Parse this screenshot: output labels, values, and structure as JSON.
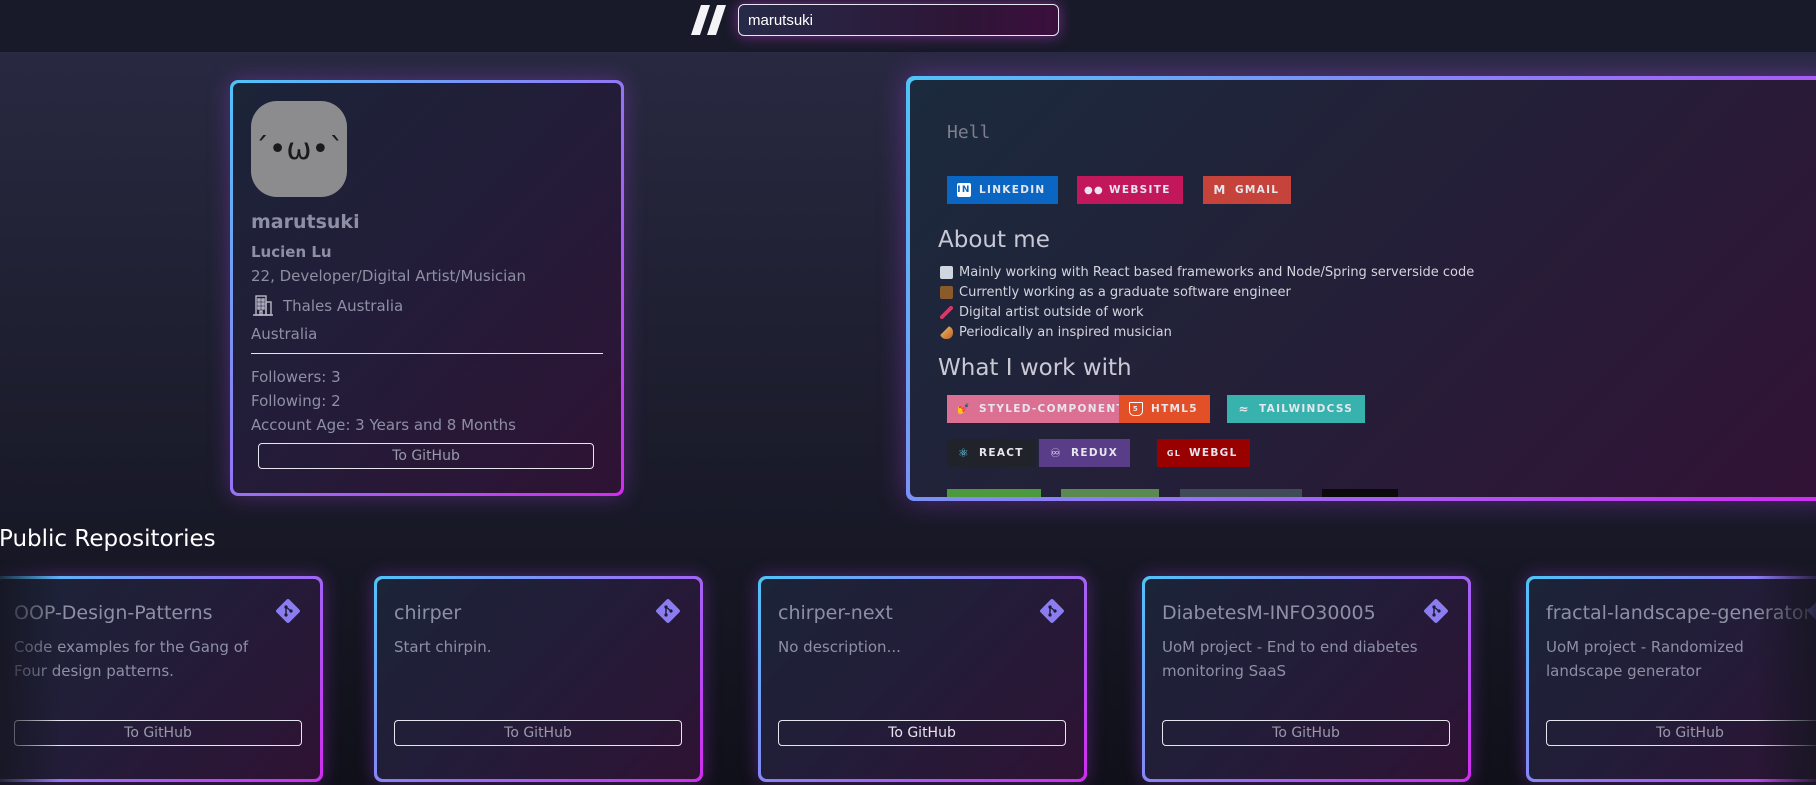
{
  "search": {
    "value": "marutsuki"
  },
  "profile": {
    "avatar_text": "´•ω•`",
    "username": "marutsuki",
    "name": "Lucien Lu",
    "bio": "22, Developer/Digital Artist/Musician",
    "company": "Thales Australia",
    "location": "Australia",
    "followers": "Followers: 3",
    "following": "Following: 2",
    "account_age": "Account Age: 3 Years and 8 Months",
    "button": "To GitHub"
  },
  "readme": {
    "typing_text": "Hell",
    "contact_badges": [
      {
        "label": "LINKEDIN",
        "color": "#0a66c2",
        "icon": "linkedin-icon"
      },
      {
        "label": "WEBSITE",
        "color": "#c2185b",
        "icon": "medium-icon"
      },
      {
        "label": "GMAIL",
        "color": "#c5433a",
        "icon": "gmail-icon"
      }
    ],
    "about_heading": "About me",
    "about_items": [
      "Mainly working with React based frameworks and Node/Spring serverside code",
      "Currently working as a graduate software engineer",
      "Digital artist outside of work",
      "Periodically an inspired musician"
    ],
    "work_heading": "What I work with",
    "tech_badges": [
      {
        "label": "STYLED-COMPONENTS",
        "color": "#db7093",
        "icon": "styled-components-icon"
      },
      {
        "label": "HTML5",
        "color": "#e34f26",
        "icon": "html5-icon"
      },
      {
        "label": "TAILWINDCSS",
        "color": "#38b2ac",
        "icon": "tailwind-icon"
      },
      {
        "label": "REACT",
        "color": "#20232a",
        "icon": "react-icon"
      },
      {
        "label": "REDUX",
        "color": "#593d88",
        "icon": "redux-icon"
      },
      {
        "label": "WEBGL",
        "color": "#990000",
        "icon": "webgl-icon"
      }
    ]
  },
  "repos_heading": "Public Repositories",
  "repos": [
    {
      "name": "OOP-Design-Patterns",
      "description": "Code examples for the Gang of Four design patterns.",
      "button": "To GitHub"
    },
    {
      "name": "chirper",
      "description": "Start chirpin.",
      "button": "To GitHub"
    },
    {
      "name": "chirper-next",
      "description": "No description...",
      "button": "To GitHub"
    },
    {
      "name": "DiabetesM-INFO30005",
      "description": "UoM project - End to end diabetes monitoring SaaS",
      "button": "To GitHub"
    },
    {
      "name": "fractal-landscape-generator",
      "description": "UoM project - Randomized landscape generator",
      "button": "To GitHub"
    }
  ],
  "colors": {
    "accent_start": "#4fc4f7",
    "accent_mid": "#8d7cf6",
    "accent_end": "#d12cf0"
  }
}
